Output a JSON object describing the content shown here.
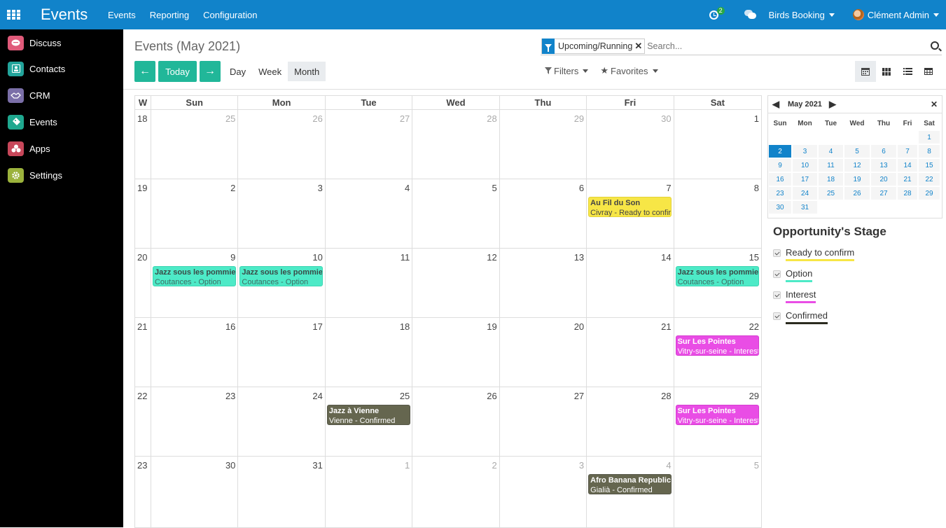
{
  "topbar": {
    "app_title": "Events",
    "menu": [
      "Events",
      "Reporting",
      "Configuration"
    ],
    "activity_count": "2",
    "company": "Birds Booking",
    "user": "Clément Admin"
  },
  "sidebar": {
    "items": [
      {
        "label": "Discuss",
        "icon": "discuss-icon",
        "color": "#e05a7a"
      },
      {
        "label": "Contacts",
        "icon": "contacts-icon",
        "color": "#22a49b"
      },
      {
        "label": "CRM",
        "icon": "crm-handshake-icon",
        "color": "#7b6fa8"
      },
      {
        "label": "Events",
        "icon": "events-ticket-icon",
        "color": "#1fa88f"
      },
      {
        "label": "Apps",
        "icon": "apps-icon",
        "color": "#c7475a"
      },
      {
        "label": "Settings",
        "icon": "settings-gear-icon",
        "color": "#9bb23c"
      }
    ]
  },
  "control_panel": {
    "title": "Events (May 2021)",
    "facet_label": "Upcoming/Running",
    "search_placeholder": "Search...",
    "today_label": "Today",
    "scales": [
      "Day",
      "Week",
      "Month"
    ],
    "active_scale": "Month",
    "filters_label": "Filters",
    "favorites_label": "Favorites"
  },
  "calendar": {
    "week_header": "W",
    "day_headers": [
      "Sun",
      "Mon",
      "Tue",
      "Wed",
      "Thu",
      "Fri",
      "Sat"
    ],
    "weeks": [
      {
        "num": "18",
        "days": [
          {
            "d": "25",
            "o": true
          },
          {
            "d": "26",
            "o": true
          },
          {
            "d": "27",
            "o": true
          },
          {
            "d": "28",
            "o": true
          },
          {
            "d": "29",
            "o": true
          },
          {
            "d": "30",
            "o": true
          },
          {
            "d": "1",
            "o": false
          }
        ]
      },
      {
        "num": "19",
        "days": [
          {
            "d": "2",
            "o": false
          },
          {
            "d": "3",
            "o": false
          },
          {
            "d": "4",
            "o": false
          },
          {
            "d": "5",
            "o": false
          },
          {
            "d": "6",
            "o": false
          },
          {
            "d": "7",
            "o": false,
            "ev": {
              "t": "Au Fil du Son",
              "s": "Civray - Ready to confirm",
              "c": "yellow"
            }
          },
          {
            "d": "8",
            "o": false
          }
        ]
      },
      {
        "num": "20",
        "days": [
          {
            "d": "9",
            "o": false,
            "ev": {
              "t": "Jazz sous les pommiers",
              "s": "Coutances - Option",
              "c": "cyan"
            }
          },
          {
            "d": "10",
            "o": false,
            "ev": {
              "t": "Jazz sous les pommiers",
              "s": "Coutances - Option",
              "c": "cyan"
            }
          },
          {
            "d": "11",
            "o": false
          },
          {
            "d": "12",
            "o": false
          },
          {
            "d": "13",
            "o": false
          },
          {
            "d": "14",
            "o": false
          },
          {
            "d": "15",
            "o": false,
            "ev": {
              "t": "Jazz sous les pommiers",
              "s": "Coutances - Option",
              "c": "cyan"
            }
          }
        ]
      },
      {
        "num": "21",
        "days": [
          {
            "d": "16",
            "o": false
          },
          {
            "d": "17",
            "o": false
          },
          {
            "d": "18",
            "o": false
          },
          {
            "d": "19",
            "o": false
          },
          {
            "d": "20",
            "o": false
          },
          {
            "d": "21",
            "o": false
          },
          {
            "d": "22",
            "o": false,
            "ev": {
              "t": "Sur Les Pointes",
              "s": "Vitry-sur-seine - Interest",
              "c": "magenta"
            }
          }
        ]
      },
      {
        "num": "22",
        "days": [
          {
            "d": "23",
            "o": false
          },
          {
            "d": "24",
            "o": false
          },
          {
            "d": "25",
            "o": false,
            "ev": {
              "t": "Jazz à Vienne",
              "s": "Vienne - Confirmed",
              "c": "olive"
            }
          },
          {
            "d": "26",
            "o": false
          },
          {
            "d": "27",
            "o": false
          },
          {
            "d": "28",
            "o": false
          },
          {
            "d": "29",
            "o": false,
            "ev": {
              "t": "Sur Les Pointes",
              "s": "Vitry-sur-seine - Interest",
              "c": "magenta"
            }
          }
        ]
      },
      {
        "num": "23",
        "days": [
          {
            "d": "30",
            "o": false
          },
          {
            "d": "31",
            "o": false
          },
          {
            "d": "1",
            "o": true
          },
          {
            "d": "2",
            "o": true
          },
          {
            "d": "3",
            "o": true
          },
          {
            "d": "4",
            "o": true,
            "ev": {
              "t": "Afro Banana Republic",
              "s": "Gialià - Confirmed",
              "c": "olive"
            }
          },
          {
            "d": "5",
            "o": true
          }
        ]
      }
    ]
  },
  "mini_calendar": {
    "month": "May 2021",
    "day_headers": [
      "Sun",
      "Mon",
      "Tue",
      "Wed",
      "Thu",
      "Fri",
      "Sat"
    ],
    "selected": "2",
    "rows": [
      [
        "",
        "",
        "",
        "",
        "",
        "",
        "1"
      ],
      [
        "2",
        "3",
        "4",
        "5",
        "6",
        "7",
        "8"
      ],
      [
        "9",
        "10",
        "11",
        "12",
        "13",
        "14",
        "15"
      ],
      [
        "16",
        "17",
        "18",
        "19",
        "20",
        "21",
        "22"
      ],
      [
        "23",
        "24",
        "25",
        "26",
        "27",
        "28",
        "29"
      ],
      [
        "30",
        "31",
        "",
        "",
        "",
        "",
        ""
      ]
    ]
  },
  "stage_filter": {
    "title": "Opportunity's Stage",
    "items": [
      {
        "label": "Ready to confirm",
        "color": "#f7e646"
      },
      {
        "label": "Option",
        "color": "#4deac7"
      },
      {
        "label": "Interest",
        "color": "#e94de5"
      },
      {
        "label": "Confirmed",
        "color": "#2b2b1f"
      }
    ]
  }
}
